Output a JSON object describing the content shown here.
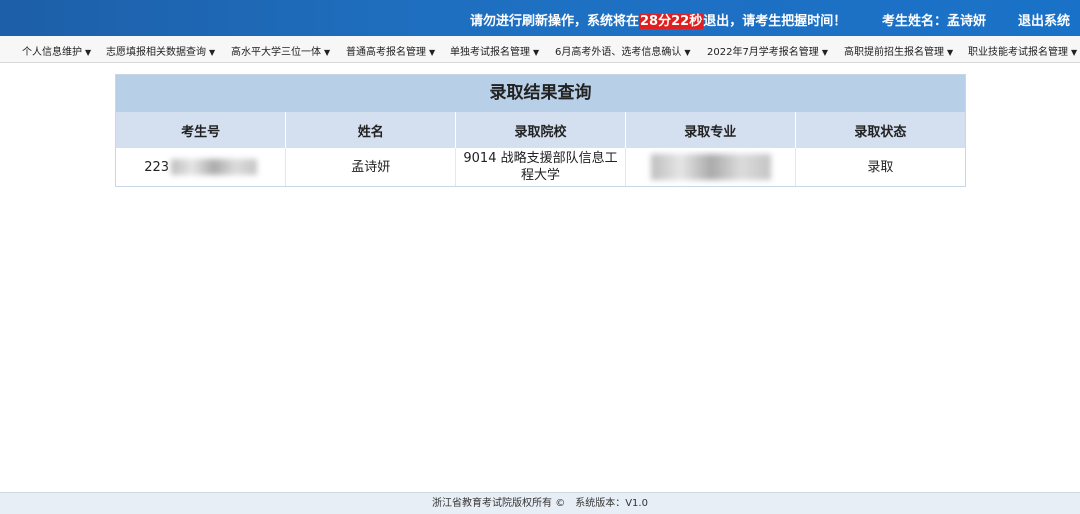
{
  "header": {
    "notice_prefix": "请勿进行刷新操作，系统将在",
    "timer": "28分22秒",
    "notice_suffix": "退出，请考生把握时间！",
    "user_label": "考生姓名：孟诗妍",
    "logout_label": "退出系统"
  },
  "nav": {
    "items": [
      {
        "label": "个人信息维护"
      },
      {
        "label": "志愿填报相关数据查询"
      },
      {
        "label": "高水平大学三位一体"
      },
      {
        "label": "普通高考报名管理"
      },
      {
        "label": "单独考试报名管理"
      },
      {
        "label": "6月高考外语、选考信息确认"
      },
      {
        "label": "2022年7月学考报名管理"
      },
      {
        "label": "高职提前招生报名管理"
      },
      {
        "label": "职业技能考试报名管理"
      }
    ]
  },
  "result": {
    "title": "录取结果查询",
    "columns": [
      "考生号",
      "姓名",
      "录取院校",
      "录取专业",
      "录取状态"
    ],
    "row": {
      "exam_no": "223",
      "name": "孟诗妍",
      "school": "9014 战略支援部队信息工程大学",
      "major": "",
      "status": "录取"
    }
  },
  "footer": {
    "copyright": "浙江省教育考试院版权所有 ©",
    "version": "系统版本：V1.0"
  }
}
